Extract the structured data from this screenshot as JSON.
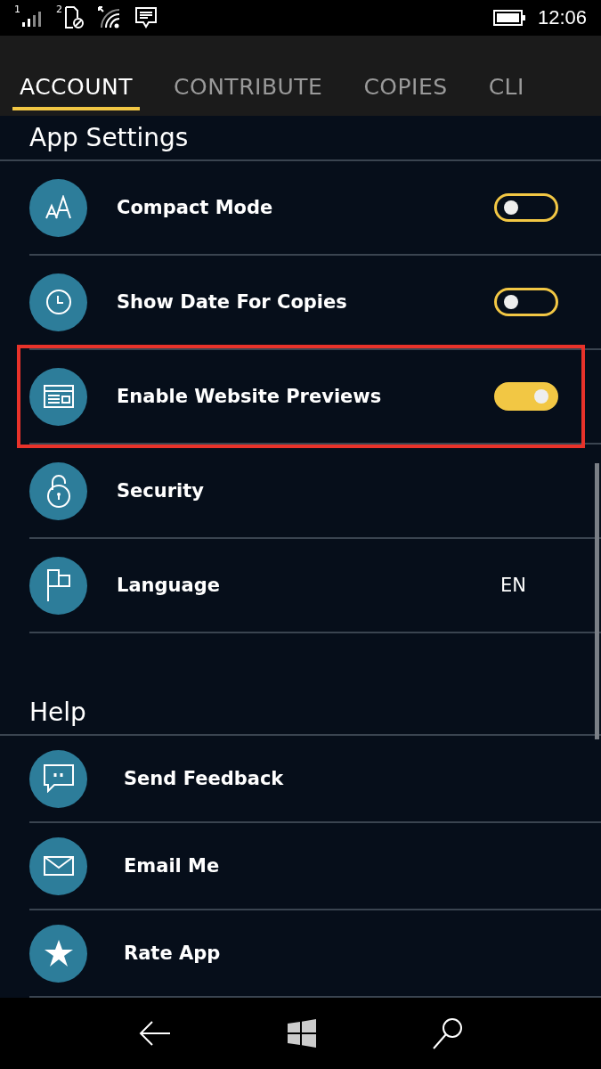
{
  "status_bar": {
    "sim_1": "1",
    "sim_2": "2",
    "time": "12:06"
  },
  "tabs": [
    {
      "label": "ACCOUNT",
      "selected": true
    },
    {
      "label": "CONTRIBUTE",
      "selected": false
    },
    {
      "label": "COPIES",
      "selected": false
    },
    {
      "label": "CLI",
      "selected": false
    }
  ],
  "sections": [
    {
      "title": "App Settings",
      "items": [
        {
          "kind": "toggle",
          "label": "Compact Mode",
          "on": false,
          "highlighted": false
        },
        {
          "kind": "toggle",
          "label": "Show Date For Copies",
          "on": false,
          "highlighted": false
        },
        {
          "kind": "toggle",
          "label": "Enable Website Previews",
          "on": true,
          "highlighted": true
        },
        {
          "kind": "link",
          "label": "Security"
        },
        {
          "kind": "value",
          "label": "Language",
          "value": "EN"
        }
      ]
    },
    {
      "title": "Help",
      "items": [
        {
          "kind": "link",
          "label": "Send Feedback"
        },
        {
          "kind": "link",
          "label": "Email Me"
        },
        {
          "kind": "link",
          "label": "Rate App"
        }
      ]
    }
  ]
}
